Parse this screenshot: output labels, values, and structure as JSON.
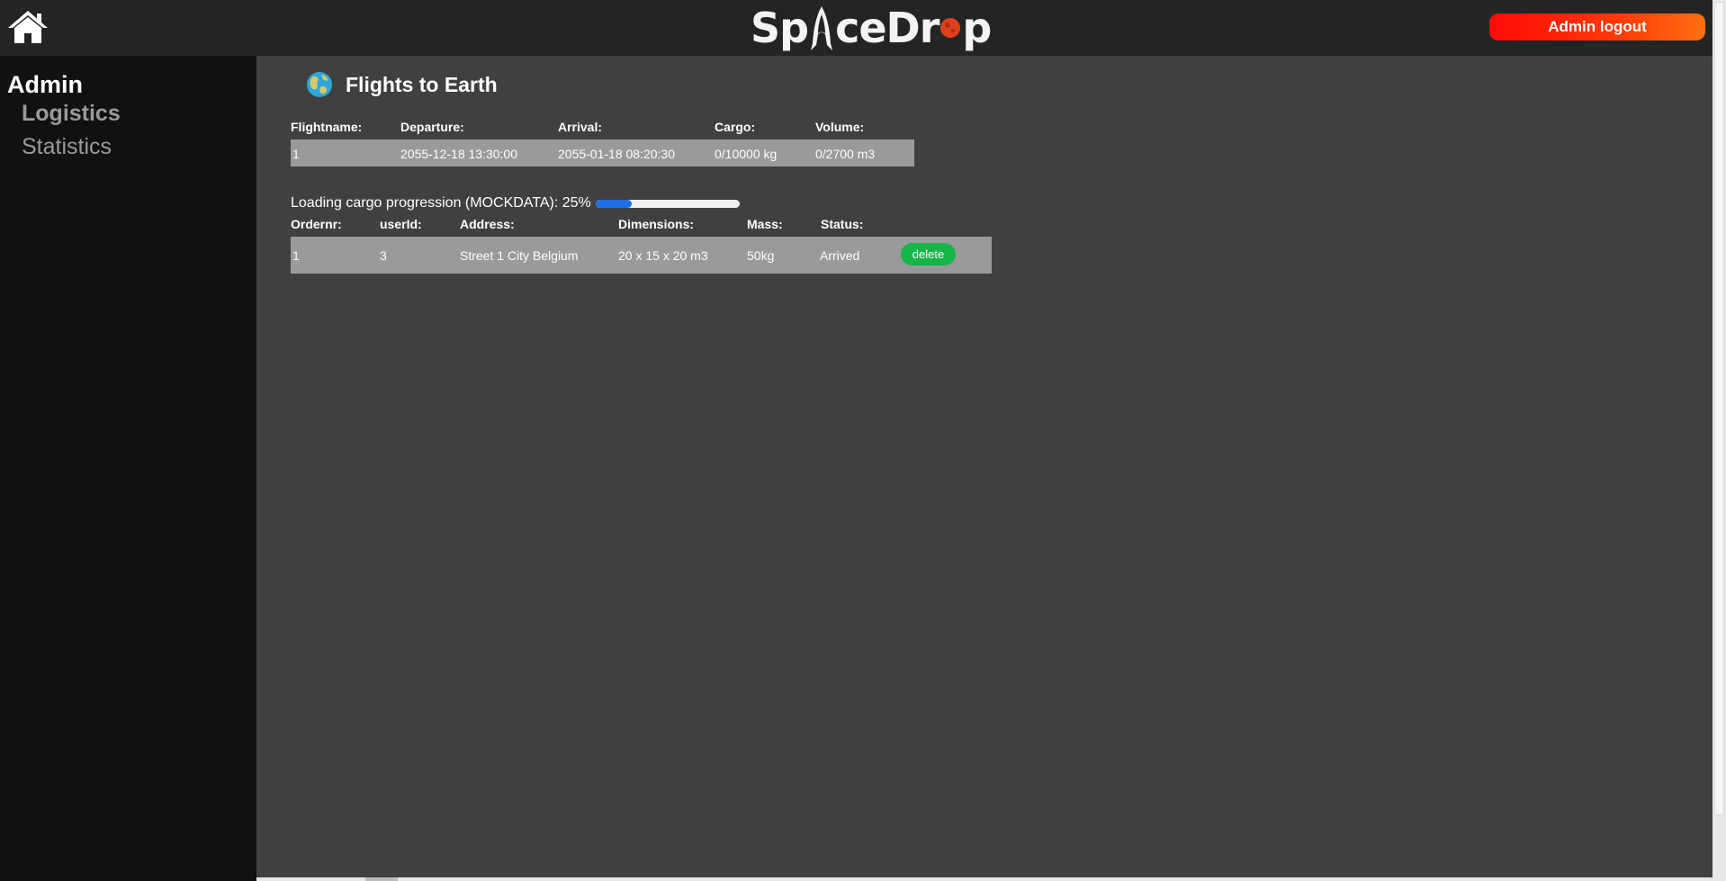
{
  "header": {
    "home_icon": "home-icon",
    "logo_parts": [
      "Sp",
      "ceDr",
      "p"
    ],
    "logout_label": "Admin logout"
  },
  "sidebar": {
    "title": "Admin",
    "items": [
      {
        "label": "Logistics"
      },
      {
        "label": "Statistics"
      }
    ]
  },
  "main": {
    "title": "Flights to Earth",
    "title_icon": "earth-icon",
    "flight_table": {
      "headers": [
        "Flightname:",
        "Departure:",
        "Arrival:",
        "Cargo:",
        "Volume:"
      ],
      "rows": [
        [
          "1",
          "2055-12-18 13:30:00",
          "2055-01-18 08:20:30",
          "0/10000 kg",
          "0/2700 m3"
        ]
      ]
    },
    "progress": {
      "label": "Loading cargo progression (MOCKDATA): 25%",
      "percent": 25
    },
    "order_table": {
      "headers": [
        "Ordernr:",
        "userId:",
        "Address:",
        "Dimensions:",
        "Mass:",
        "Status:"
      ],
      "rows": [
        [
          "1",
          "3",
          "Street 1 City Belgium",
          "20 x 15 x 20 m3",
          "50kg",
          "Arrived"
        ]
      ],
      "delete_label": "delete"
    }
  },
  "colors": {
    "topbar": "#242424",
    "sidebar": "#111111",
    "main_bg": "#404040",
    "row_bg": "#9a9a9a",
    "logout_gradient": [
      "#ff0a08",
      "#ff7012"
    ],
    "delete_green": "#16b54a",
    "progress_blue": "#1f6fe8"
  }
}
